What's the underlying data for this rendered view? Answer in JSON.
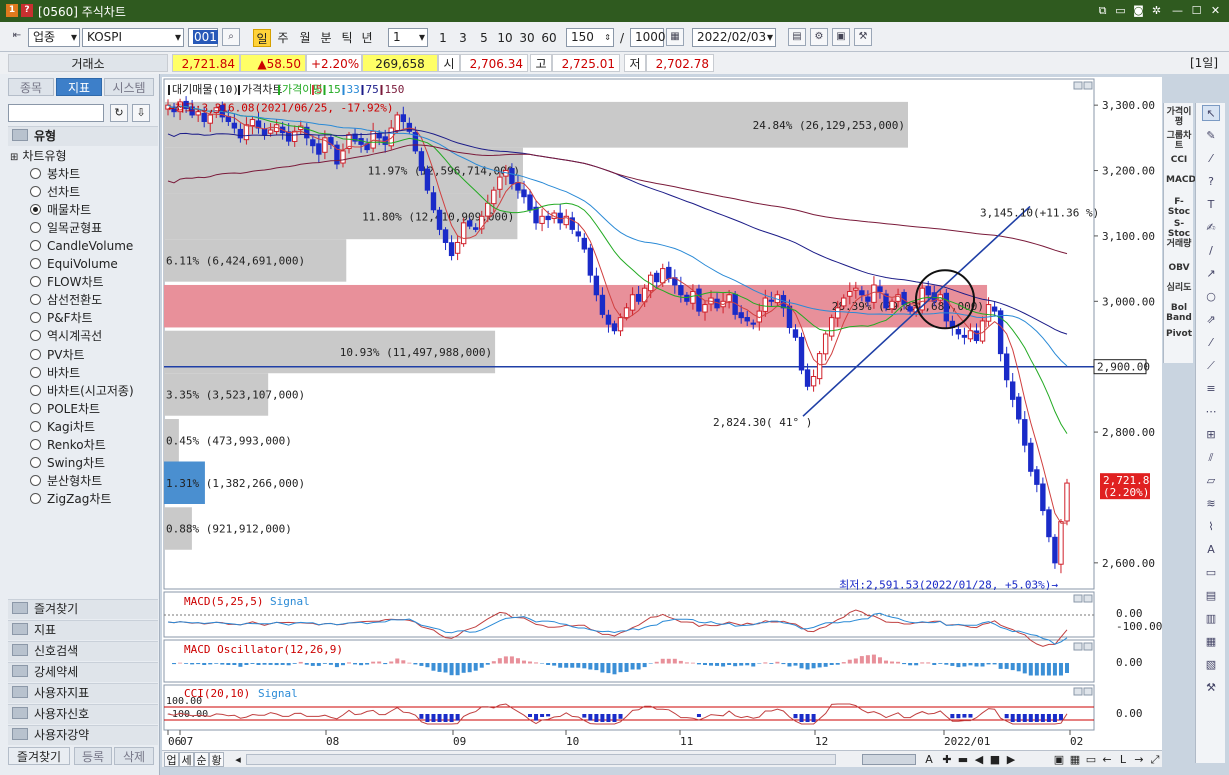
{
  "window": {
    "title": "[0560] 주식차트",
    "icon_1": "1",
    "icon_2": "?"
  },
  "toolbar": {
    "market": "업종",
    "index": "KOSPI",
    "code": "001",
    "periods": [
      "일",
      "주",
      "월",
      "분",
      "틱",
      "년"
    ],
    "interval_value": "1",
    "quick_intervals": [
      "1",
      "3",
      "5",
      "10",
      "30",
      "60"
    ],
    "count": "150",
    "separator": "/",
    "max_count": "1000",
    "date": "2022/02/03"
  },
  "quote": {
    "exchange": "거래소",
    "price": "2,721.84",
    "change": "▲58.50",
    "pct": "+2.20%",
    "volume": "269,658",
    "open_label": "시",
    "open": "2,706.34",
    "high_label": "고",
    "high": "2,725.01",
    "low_label": "저",
    "low": "2,702.78",
    "period_badge": "[1일]"
  },
  "left": {
    "tabs": [
      "종목",
      "지표",
      "시스템"
    ],
    "tree_root": "유형",
    "tree_group": "차트유형",
    "chart_types": [
      "봉차트",
      "선차트",
      "매물차트",
      "일목균형표",
      "CandleVolume",
      "EquiVolume",
      "FLOW차트",
      "삼선전환도",
      "P&F차트",
      "역시계곡선",
      "PV차트",
      "바차트",
      "바차트(시고저종)",
      "POLE차트",
      "Kagi차트",
      "Renko차트",
      "Swing차트",
      "분산형차트",
      "ZigZag차트"
    ],
    "selected_index": 2,
    "folders": [
      "즐겨찾기",
      "지표",
      "신호검색",
      "강세약세",
      "사용자지표",
      "사용자신호",
      "사용자강약"
    ],
    "bottom_tabs": [
      "즐겨찾기",
      "등록",
      "삭제"
    ]
  },
  "legend": {
    "vp": "대기매물(10)",
    "price": "가격차트",
    "ma_label": "가격이평",
    "ma": [
      "5",
      "15",
      "33",
      "75",
      "150"
    ]
  },
  "colors": {
    "up": "#d0202a",
    "down": "#1a2bc8",
    "ma5": "#d04040",
    "ma15": "#22aa22",
    "ma33": "#2a8ad6",
    "ma75": "#1c1c88",
    "ma150": "#7a1a3a",
    "vp_bar": "#c9c9c9",
    "vp_active": "#e8909a",
    "vp_blue": "#4a8fd0",
    "trend": "#1f3fa6"
  },
  "annotations": {
    "high": "←최고:3,316.08(2021/06/25, -17.92%)",
    "low": "최저:2,591.53(2022/01/28, +5.03%)→",
    "trend_end": "3,145.10(+11.36 %)",
    "trend_start": "2,824.30( 41° )",
    "hline": "2,900.00",
    "last_price": "2,721.84",
    "last_pct": "(2.20%)"
  },
  "chart_data": {
    "type": "candlestick",
    "y_ticks": [
      "3,300.00",
      "3,200.00",
      "3,100.00",
      "3,000.00",
      "2,800.00",
      "2,600.00"
    ],
    "ylim": [
      2560,
      3340
    ],
    "x_ticks": [
      "06",
      "07",
      "08",
      "09",
      "10",
      "11",
      "12",
      "2022/01",
      "02"
    ],
    "volume_profile": [
      {
        "label": "24.84% (26,129,253,000)",
        "low": 3235,
        "high": 3305,
        "ratio": 0.8
      },
      {
        "label": "11.97% (12,596,714,000)",
        "low": 3165,
        "high": 3235,
        "ratio": 0.386
      },
      {
        "label": "11.80% (12,410,909,000)",
        "low": 3095,
        "high": 3165,
        "ratio": 0.38
      },
      {
        "label": "6.11% (6,424,691,000)",
        "low": 3030,
        "high": 3095,
        "ratio": 0.196
      },
      {
        "label": "28.39% (29,838,685,000)",
        "low": 2960,
        "high": 3025,
        "ratio": 0.885,
        "active": true
      },
      {
        "label": "10.93% (11,497,988,000)",
        "low": 2890,
        "high": 2955,
        "ratio": 0.356
      },
      {
        "label": "3.35% (3,523,107,000)",
        "low": 2825,
        "high": 2890,
        "ratio": 0.112
      },
      {
        "label": "0.45% (473,993,000)",
        "low": 2755,
        "high": 2820,
        "ratio": 0.016
      },
      {
        "label": "1.31% (1,382,266,000)",
        "low": 2690,
        "high": 2755,
        "ratio": 0.044,
        "blue": true
      },
      {
        "label": "0.88% (921,912,000)",
        "low": 2620,
        "high": 2685,
        "ratio": 0.03
      }
    ],
    "closes": [
      3300,
      3290,
      3305,
      3295,
      3285,
      3290,
      3275,
      3285,
      3296,
      3282,
      3275,
      3265,
      3250,
      3270,
      3278,
      3265,
      3255,
      3262,
      3270,
      3258,
      3245,
      3260,
      3268,
      3250,
      3238,
      3225,
      3250,
      3240,
      3210,
      3230,
      3255,
      3245,
      3240,
      3232,
      3260,
      3250,
      3240,
      3265,
      3285,
      3275,
      3260,
      3230,
      3200,
      3170,
      3140,
      3110,
      3090,
      3070,
      3090,
      3120,
      3115,
      3110,
      3130,
      3150,
      3170,
      3190,
      3200,
      3180,
      3170,
      3160,
      3140,
      3120,
      3130,
      3125,
      3135,
      3120,
      3130,
      3110,
      3100,
      3080,
      3040,
      3010,
      2980,
      2965,
      2955,
      2975,
      2990,
      3010,
      3000,
      3020,
      3040,
      3030,
      3050,
      3035,
      3025,
      3010,
      3000,
      3015,
      2985,
      2995,
      3005,
      2990,
      3000,
      3010,
      2980,
      2975,
      2970,
      2965,
      2985,
      3005,
      3000,
      3010,
      2990,
      2960,
      2945,
      2895,
      2870,
      2885,
      2920,
      2950,
      2975,
      2990,
      3005,
      3015,
      3020,
      3010,
      3000,
      3025,
      3015,
      2990,
      3000,
      3010,
      2995,
      2985,
      2990,
      3020,
      3010,
      3000,
      3010,
      2970,
      2960,
      2950,
      2945,
      2955,
      2940,
      2970,
      2995,
      2985,
      2920,
      2880,
      2850,
      2820,
      2780,
      2740,
      2720,
      2680,
      2640,
      2600,
      2663,
      2722
    ],
    "ma_periods": [
      5,
      15,
      33,
      75,
      150
    ],
    "macd": {
      "label": "MACD(5,25,5)",
      "signal": "Signal",
      "ticks": [
        "0.00",
        "-100.00"
      ]
    },
    "osc": {
      "label": "MACD Oscillator(12,26,9)",
      "ticks": [
        "0.00"
      ]
    },
    "cci": {
      "label": "CCI(20,10)",
      "signal": "Signal",
      "ticks": [
        "0.00"
      ],
      "levels": [
        "100.00",
        "-100.00"
      ]
    }
  },
  "right_labels": [
    "가격이평",
    "그룹차트",
    "CCI",
    "MACD",
    "F-Stoc",
    "S-Stoc",
    "거래량",
    "OBV",
    "심리도",
    "Bol Band",
    "Pivot"
  ],
  "bottom": {
    "buttons": [
      "업",
      "세",
      "순",
      "황"
    ],
    "zoom_label": "A"
  }
}
